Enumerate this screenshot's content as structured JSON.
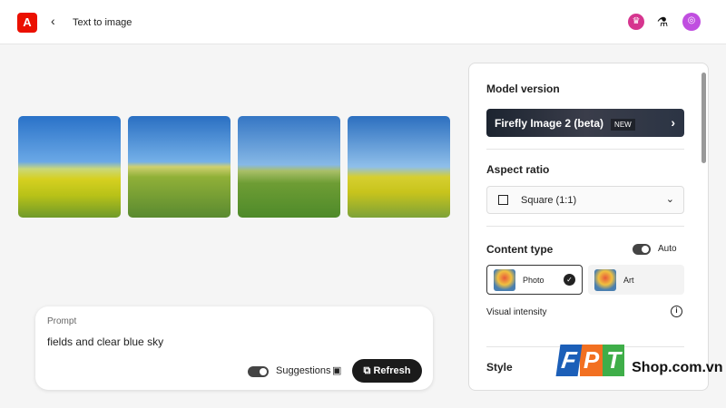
{
  "header": {
    "logo": "A",
    "back_icon": "chevron-left-icon",
    "title": "Text to image"
  },
  "prompt": {
    "label": "Prompt",
    "value": "fields and clear blue sky",
    "suggestions_label": "Suggestions",
    "refresh_label": "Refresh"
  },
  "panel": {
    "model_version": {
      "heading": "Model version",
      "value": "Firefly Image 2 (beta)",
      "badge": "NEW"
    },
    "aspect_ratio": {
      "heading": "Aspect ratio",
      "value": "Square (1:1)"
    },
    "content_type": {
      "heading": "Content type",
      "auto_label": "Auto",
      "options": [
        {
          "label": "Photo",
          "selected": true
        },
        {
          "label": "Art",
          "selected": false
        }
      ]
    },
    "visual_intensity": "Visual intensity",
    "style": {
      "heading": "Style"
    }
  },
  "watermark": {
    "brand": "FPT",
    "suffix": "Shop.com.vn"
  }
}
